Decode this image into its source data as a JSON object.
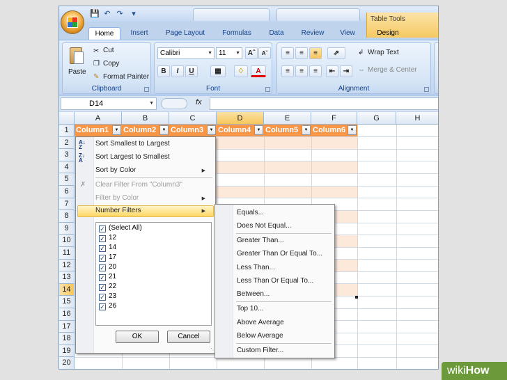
{
  "title_bar": {
    "qat": [
      "save-icon",
      "undo-icon",
      "redo-icon",
      "customize-qat-icon"
    ],
    "context_tab": "Table Tools"
  },
  "ribbon_tabs": [
    "Home",
    "Insert",
    "Page Layout",
    "Formulas",
    "Data",
    "Review",
    "View",
    "Design"
  ],
  "clipboard": {
    "paste": "Paste",
    "cut": "Cut",
    "copy": "Copy",
    "format_painter": "Format Painter",
    "label": "Clipboard"
  },
  "font": {
    "family": "Calibri",
    "size": "11",
    "bold": "B",
    "italic": "I",
    "underline": "U",
    "font_color_glyph": "A",
    "label": "Font"
  },
  "alignment": {
    "wrap_text": "Wrap Text",
    "merge_center": "Merge & Center",
    "label": "Alignment"
  },
  "formula_bar": {
    "name_box": "D14",
    "fx": "fx",
    "formula": ""
  },
  "columns": [
    "A",
    "B",
    "C",
    "D",
    "E",
    "F",
    "G",
    "H"
  ],
  "rows": [
    "1",
    "2",
    "3",
    "4",
    "5",
    "6",
    "7",
    "8",
    "9",
    "10",
    "11",
    "12",
    "13",
    "14",
    "15",
    "16",
    "17",
    "18",
    "19",
    "20"
  ],
  "header_cells": [
    "Column1",
    "Column2",
    "Column3",
    "Column4",
    "Column5",
    "Column6"
  ],
  "filter_menu": {
    "sort_asc": "Sort Smallest to Largest",
    "sort_desc": "Sort Largest to Smallest",
    "sort_color": "Sort by Color",
    "clear_filter": "Clear Filter From \"Column3\"",
    "filter_color": "Filter by Color",
    "number_filters": "Number Filters",
    "list": [
      "(Select All)",
      "12",
      "14",
      "17",
      "20",
      "21",
      "22",
      "23",
      "26"
    ],
    "ok": "OK",
    "cancel": "Cancel"
  },
  "number_filters_menu": [
    "Equals...",
    "Does Not Equal...",
    "Greater Than...",
    "Greater Than Or Equal To...",
    "Less Than...",
    "Less Than Or Equal To...",
    "Between...",
    "Top 10...",
    "Above Average",
    "Below Average",
    "Custom Filter..."
  ],
  "watermark": {
    "part1": "wiki",
    "part2": "How"
  },
  "colors": {
    "table_header": "#f79646",
    "band": "#fde9d9",
    "ribbon": "#c7dbf3",
    "context_tab": "#f6c962"
  }
}
